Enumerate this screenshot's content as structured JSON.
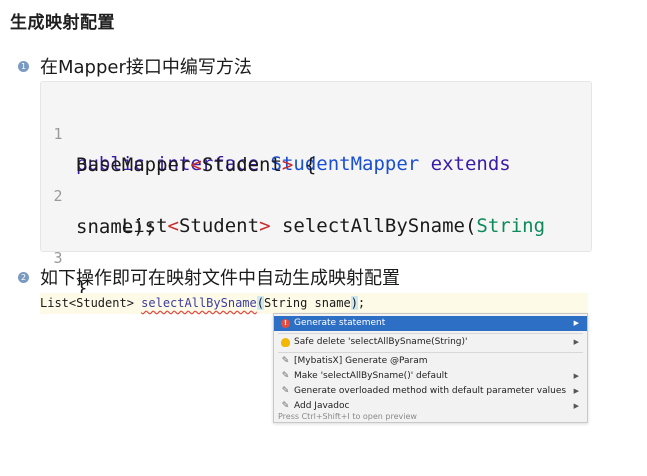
{
  "heading": "生成映射配置",
  "steps": [
    {
      "number": "1",
      "text": "在Mapper接口中编写方法"
    },
    {
      "number": "2",
      "text": "如下操作即可在映射文件中自动生成映射配置"
    }
  ],
  "code_block": {
    "line_numbers": [
      "1",
      "2",
      "3"
    ],
    "line1a": {
      "kw1": "public",
      "kw2": "interface",
      "cls": "StudentMapper",
      "kw3": "extends"
    },
    "line1b": {
      "base": "BaseMapper",
      "lt": "<",
      "gen": "Student",
      "gt": ">",
      "brace": " {"
    },
    "line2a": {
      "list": "List",
      "lt": "<",
      "gen": "Student",
      "gt": ">",
      "method": " selectAllBySname(",
      "ptype": "String"
    },
    "line2b": "sname);",
    "line3": "}"
  },
  "ide": {
    "code_prefix": "List<Student> ",
    "code_method": "selectAllBySname",
    "code_paren_open": "(",
    "code_args": "String sname",
    "code_paren_close": ")",
    "code_suffix": ";",
    "menu": [
      {
        "icon": "error-icon",
        "label": "Generate statement",
        "has_submenu": true,
        "selected": true
      },
      {
        "icon": "bulb-icon",
        "label": "Safe delete 'selectAllBySname(String)'",
        "has_submenu": true
      },
      {
        "icon": "pencil-icon",
        "label": "[MybatisX] Generate @Param",
        "has_submenu": false
      },
      {
        "icon": "pencil-icon",
        "label": "Make 'selectAllBySname()' default",
        "has_submenu": true
      },
      {
        "icon": "pencil-icon",
        "label": "Generate overloaded method with default parameter values",
        "has_submenu": true
      },
      {
        "icon": "pencil-icon",
        "label": "Add Javadoc",
        "has_submenu": true
      }
    ],
    "footer": "Press Ctrl+Shift+I to open preview"
  },
  "colors": {
    "selected_bg": "#2e6fc6",
    "keyword": "#3a1ba7",
    "type": "#1a4fd4",
    "operator": "#c82a2a",
    "param_type": "#0d8a5a"
  }
}
